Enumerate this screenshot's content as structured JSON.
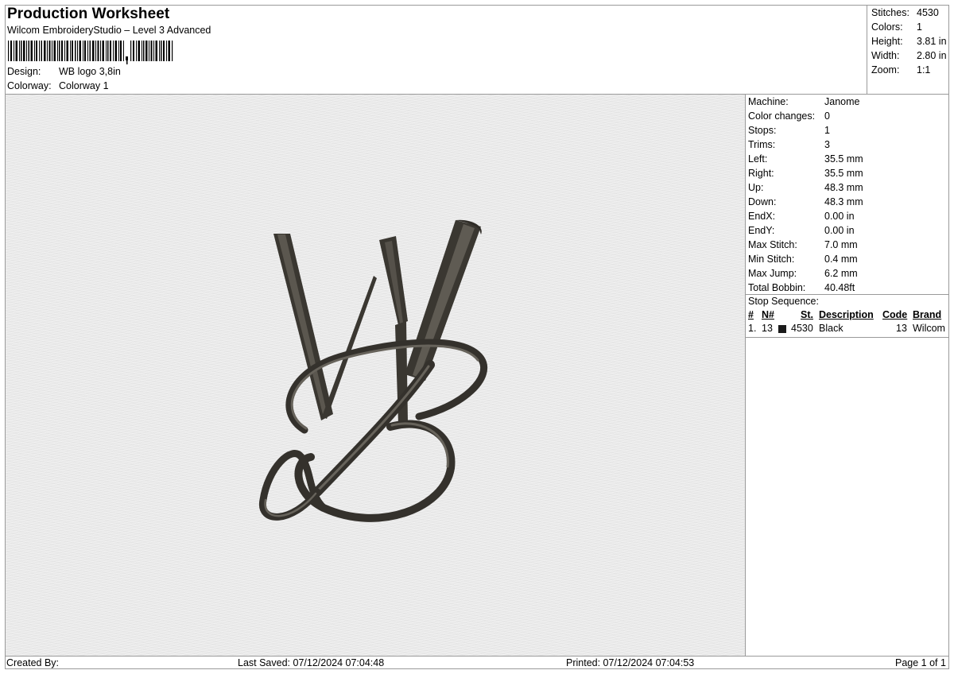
{
  "header": {
    "title": "Production Worksheet",
    "subtitle": "Wilcom EmbroideryStudio – Level 3 Advanced",
    "design_label": "Design:",
    "design_value": "WB logo 3,8in",
    "colorway_label": "Colorway:",
    "colorway_value": "Colorway 1"
  },
  "stats": [
    {
      "label": "Stitches:",
      "value": "4530"
    },
    {
      "label": "Colors:",
      "value": "1"
    },
    {
      "label": "Height:",
      "value": "3.81 in"
    },
    {
      "label": "Width:",
      "value": "2.80 in"
    },
    {
      "label": "Zoom:",
      "value": "1:1"
    }
  ],
  "info": [
    {
      "label": "Machine:",
      "value": "Janome"
    },
    {
      "label": "Color changes:",
      "value": "0"
    },
    {
      "label": "Stops:",
      "value": "1"
    },
    {
      "label": "Trims:",
      "value": "3"
    },
    {
      "label": "Left:",
      "value": "35.5 mm"
    },
    {
      "label": "Right:",
      "value": "35.5 mm"
    },
    {
      "label": "Up:",
      "value": "48.3 mm"
    },
    {
      "label": "Down:",
      "value": "48.3 mm"
    },
    {
      "label": "EndX:",
      "value": "0.00 in"
    },
    {
      "label": "EndY:",
      "value": "0.00 in"
    },
    {
      "label": "Max Stitch:",
      "value": "7.0 mm"
    },
    {
      "label": "Min Stitch:",
      "value": "0.4 mm"
    },
    {
      "label": "Max Jump:",
      "value": "6.2 mm"
    },
    {
      "label": "Total Bobbin:",
      "value": "40.48ft"
    }
  ],
  "stop_sequence": {
    "title": "Stop Sequence:",
    "headers": {
      "num": "#",
      "n": "N#",
      "st": "St.",
      "description": "Description",
      "code": "Code",
      "brand": "Brand"
    },
    "rows": [
      {
        "num": "1.",
        "n": "13",
        "st": "4530",
        "description": "Black",
        "code": "13",
        "brand": "Wilcom",
        "swatch_color": "#1a1a1a"
      }
    ]
  },
  "footer": {
    "created_by": "Created By:",
    "last_saved": "Last Saved: 07/12/2024 07:04:48",
    "printed": "Printed: 07/12/2024 07:04:53",
    "page": "Page 1 of 1"
  },
  "colors": {
    "thread": "#3d3a34",
    "background": "#e9e9e9",
    "border": "#9a9a9a"
  }
}
